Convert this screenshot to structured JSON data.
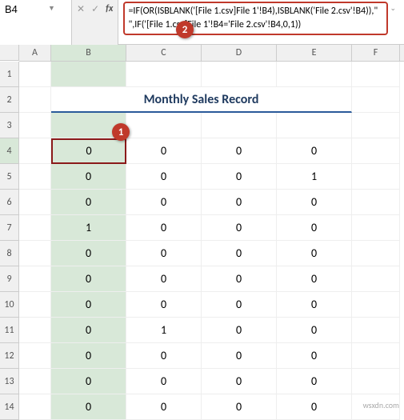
{
  "name_box": "B4",
  "formula": "=IF(OR(ISBLANK('[File 1.csv]File 1'!B4),ISBLANK('File 2.csv'!B4)),\"  \",IF('[File 1.csv]File 1'!B4='File 2.csv'!B4,0,1))",
  "callouts": {
    "one": "1",
    "two": "2"
  },
  "title": "Monthly Sales Record",
  "columns": [
    "A",
    "B",
    "C",
    "D",
    "E",
    "F"
  ],
  "row_numbers": [
    "1",
    "2",
    "3",
    "4",
    "5",
    "6",
    "7",
    "8",
    "9",
    "10",
    "11",
    "12",
    "13",
    "14"
  ],
  "grid": {
    "r4": {
      "B": "0",
      "C": "0",
      "D": "0",
      "E": "0"
    },
    "r5": {
      "B": "0",
      "C": "0",
      "D": "0",
      "E": "1"
    },
    "r6": {
      "B": "0",
      "C": "0",
      "D": "0",
      "E": "0"
    },
    "r7": {
      "B": "1",
      "C": "0",
      "D": "0",
      "E": "0"
    },
    "r8": {
      "B": "0",
      "C": "0",
      "D": "0",
      "E": "0"
    },
    "r9": {
      "B": "0",
      "C": "0",
      "D": "0",
      "E": "0"
    },
    "r10": {
      "B": "0",
      "C": "0",
      "D": "0",
      "E": "0"
    },
    "r11": {
      "B": "0",
      "C": "1",
      "D": "0",
      "E": "0"
    },
    "r12": {
      "B": "0",
      "C": "0",
      "D": "0",
      "E": "0"
    },
    "r13": {
      "B": "0",
      "C": "0",
      "D": "0",
      "E": "0"
    },
    "r14": {
      "B": "0",
      "C": "0",
      "D": "0",
      "E": "0"
    }
  },
  "watermark": "wsxdn.com"
}
